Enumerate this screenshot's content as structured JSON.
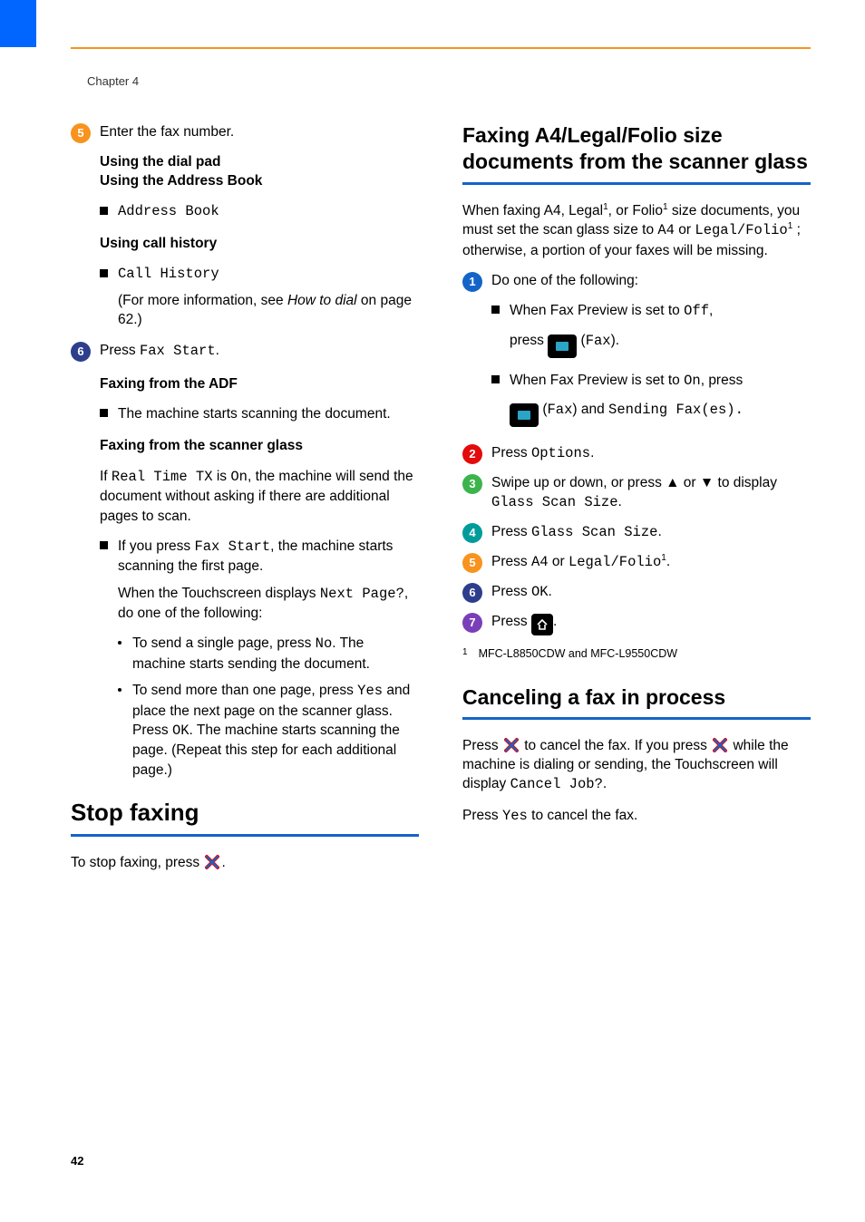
{
  "header": {
    "chapter": "Chapter 4"
  },
  "footer": {
    "page": "42"
  },
  "left": {
    "step5": {
      "num": "5",
      "text": "Enter the fax number."
    },
    "headings": {
      "dial_pad": "Using the dial pad",
      "address_book": "Using the Address Book",
      "call_history": "Using call history",
      "adf": "Faxing from the ADF",
      "scanner": "Faxing from the scanner glass"
    },
    "items": {
      "address_book": "Address Book",
      "call_history": "Call History"
    },
    "dial_ref": {
      "pre": " (For more information, see ",
      "link": "How to dial",
      "post": " on page 62.)"
    },
    "step6": {
      "num": "6",
      "pre": "Press ",
      "mono": "Fax Start",
      "post": "."
    },
    "adf": {
      "text": "The machine starts scanning the document."
    },
    "scanner": {
      "rt_pre": "If ",
      "rt_mono1": "Real Time TX",
      "rt_mid": " is ",
      "rt_mono2": "On",
      "rt_post": ", the machine will send the document without asking if there are additional pages to scan.",
      "fs_pre": "If you press ",
      "fs_mono": "Fax Start",
      "fs_post": ", the machine starts scanning the first page.",
      "np_pre": "When the Touchscreen displays ",
      "np_mono": "Next Page?",
      "np_post": ", do one of the following:",
      "single_pre": "To send a single page, press ",
      "single_mono": "No",
      "single_post": ". The machine starts sending the document.",
      "multi_pre": "To send more than one page, press ",
      "multi_mono1": "Yes",
      "multi_mid1": " and place the next page on the scanner glass. Press ",
      "multi_mono2": "OK",
      "multi_post": ". The machine starts scanning the page. (Repeat this step for each additional page.)"
    },
    "stop": {
      "heading": "Stop faxing",
      "text_pre": "To stop faxing, press ",
      "text_post": "."
    }
  },
  "right": {
    "a4": {
      "heading": "Faxing A4/Legal/Folio size documents from the scanner glass",
      "sup": "1",
      "intro_p1": "When faxing A4, Legal",
      "intro_p2": ", or Folio",
      "intro_p3": " size documents, you must set the scan glass size to ",
      "intro_mono1": "A4",
      "intro_p4": " or ",
      "intro_mono2": "Legal/Folio",
      "intro_p5": " ; otherwise, a portion of your faxes will be missing."
    },
    "steps": [
      {
        "num": "1",
        "text": "Do one of the following:"
      },
      {
        "num": "2",
        "pre": "Press ",
        "mono": "Options",
        "post": "."
      },
      {
        "num": "3",
        "pre": "Swipe up or down, or press ",
        "arrows": "▲ or ▼",
        "mid": " to display ",
        "mono": "Glass Scan Size",
        "post": "."
      },
      {
        "num": "4",
        "pre": "Press ",
        "mono": "Glass Scan Size",
        "post": "."
      },
      {
        "num": "5",
        "pre": "Press ",
        "mono1": "A4",
        "mid": " or ",
        "mono2": "Legal/Folio",
        "post": "."
      },
      {
        "num": "6",
        "pre": "Press ",
        "mono": "OK",
        "post": "."
      },
      {
        "num": "7",
        "pre": "Press ",
        "post": "."
      }
    ],
    "preview_off": {
      "line1_pre": "When Fax Preview is set to ",
      "line1_mono": "Off",
      "line1_post": ",",
      "line2_pre": "press ",
      "line2_mono": "Fax"
    },
    "preview_on": {
      "line1_pre": "When Fax Preview is set to ",
      "line1_mono": "On",
      "line1_post": ", press",
      "line2_mono1": "Fax",
      "line2_and": "and",
      "line2_mono2": "Sending Fax(es)."
    },
    "footnote": {
      "num": "1",
      "text": "MFC-L8850CDW and MFC-L9550CDW"
    },
    "cancel": {
      "heading": "Canceling a fax in process",
      "p1_pre": "Press ",
      "p1_mid": " to cancel the fax. If you press ",
      "p1_post": " while the machine is dialing or sending, the Touchscreen will display ",
      "p1_mono": "Cancel Job?",
      "p2_pre": "Press ",
      "p2_mono": "Yes",
      "p2_post": " to cancel the fax."
    }
  }
}
